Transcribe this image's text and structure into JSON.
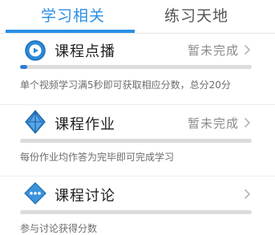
{
  "tabs": [
    {
      "label": "学习相关",
      "active": true
    },
    {
      "label": "练习天地",
      "active": false
    }
  ],
  "items": [
    {
      "title": "课程点播",
      "status": "暂未完成",
      "icon": "video-play-icon",
      "progress": 0.03,
      "description": "单个视频学习满5秒即可获取相应分数，总分20分"
    },
    {
      "title": "课程作业",
      "status": "暂未完成",
      "icon": "homework-icon",
      "progress": 0,
      "description": "每份作业均作答为完毕即可完成学习"
    },
    {
      "title": "课程讨论",
      "status": "",
      "icon": "discussion-icon",
      "progress": 0,
      "description": "参与讨论获得分数"
    }
  ],
  "colors": {
    "accent": "#2a8ee6",
    "progress": "#2a7fd4",
    "track": "#dcdcdc",
    "muted_text": "#6d6d6d"
  }
}
